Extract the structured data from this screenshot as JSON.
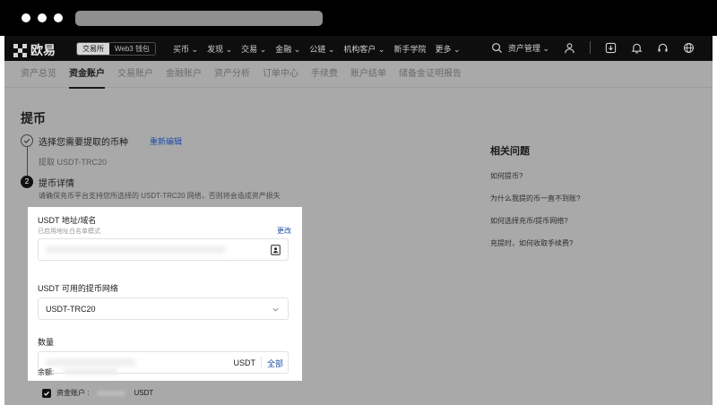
{
  "browser": {
    "dots": 3
  },
  "topnav": {
    "logo_text": "欧易",
    "mode_tabs": [
      {
        "label": "交易所",
        "active": true
      },
      {
        "label": "Web3 钱包",
        "active": false
      }
    ],
    "menu": [
      {
        "label": "买币",
        "has_dropdown": true
      },
      {
        "label": "发现",
        "has_dropdown": true
      },
      {
        "label": "交易",
        "has_dropdown": true
      },
      {
        "label": "金融",
        "has_dropdown": true
      },
      {
        "label": "公链",
        "has_dropdown": true
      },
      {
        "label": "机构客户",
        "has_dropdown": true
      },
      {
        "label": "新手学院",
        "has_dropdown": false
      },
      {
        "label": "更多",
        "has_dropdown": true
      }
    ],
    "asset_management": "资产管理",
    "icons": [
      "search-icon",
      "user-icon",
      "download-icon",
      "bell-icon",
      "headset-icon",
      "globe-icon"
    ]
  },
  "subtabs": [
    {
      "label": "资产总览",
      "active": false
    },
    {
      "label": "资金账户",
      "active": true
    },
    {
      "label": "交易账户",
      "active": false
    },
    {
      "label": "金融账户",
      "active": false
    },
    {
      "label": "资产分析",
      "active": false
    },
    {
      "label": "订单中心",
      "active": false
    },
    {
      "label": "手续费",
      "active": false
    },
    {
      "label": "账户结单",
      "active": false
    },
    {
      "label": "储备金证明报告",
      "active": false
    }
  ],
  "page": {
    "title": "提币",
    "step1": {
      "title": "选择您需要提取的币种",
      "edit": "重新编辑",
      "selected": "提取 USDT-TRC20"
    },
    "step2": {
      "number": "2",
      "title": "提币详情",
      "note": "请确保充币平台支持您所选择的 USDT-TRC20 网络，否则将会造成资产损失"
    }
  },
  "form": {
    "address": {
      "label": "USDT 地址/域名",
      "hint": "已启用地址白名单模式",
      "change": "更改"
    },
    "network": {
      "label": "USDT 可用的提币网络",
      "value": "USDT-TRC20"
    },
    "amount": {
      "label": "数量",
      "unit": "USDT",
      "all": "全部",
      "balance_label": "余额:"
    },
    "funding_account": {
      "label": "资金账户 :",
      "unit": "USDT",
      "checked": true
    }
  },
  "faq": {
    "title": "相关问题",
    "items": [
      "如何提币?",
      "为什么我提的币一直不到账?",
      "如何选择充币/提币网络?",
      "充提时，如何收取手续费?"
    ]
  },
  "colors": {
    "link": "#1f4ea3",
    "nav_bg": "#0e0e0e",
    "overlay": "#a9a9a9",
    "panel": "#ffffff"
  }
}
